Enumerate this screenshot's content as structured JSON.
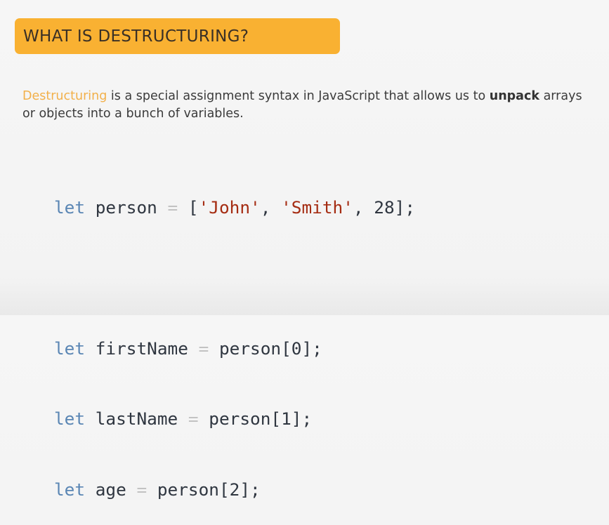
{
  "slide": {
    "title": "WHAT IS DESTRUCTURING?",
    "intro": {
      "term": "Destructuring",
      "text_before_bold": " is a special assignment syntax in JavaScript that allows us to ",
      "bold": "unpack",
      "text_after_bold": " arrays or objects into a bunch of variables."
    }
  },
  "code": {
    "lines": [
      {
        "keyword": "let",
        "name": "person",
        "operator": "=",
        "open": "[",
        "str1": "'John'",
        "sep1": ", ",
        "str2": "'Smith'",
        "sep2": ", ",
        "num": "28",
        "close": "];"
      },
      {
        "keyword": "let",
        "name": "firstName",
        "operator": "=",
        "rhs": "person[0];"
      },
      {
        "keyword": "let",
        "name": "lastName",
        "operator": "=",
        "rhs": "person[1];"
      },
      {
        "keyword": "let",
        "name": "age",
        "operator": "=",
        "rhs": "person[2];"
      }
    ]
  },
  "colors": {
    "banner": "#f9b132",
    "accent_term": "#f2b04a",
    "keyword": "#5a86b4",
    "string": "#a52c12",
    "operator": "#c2c2c2"
  }
}
